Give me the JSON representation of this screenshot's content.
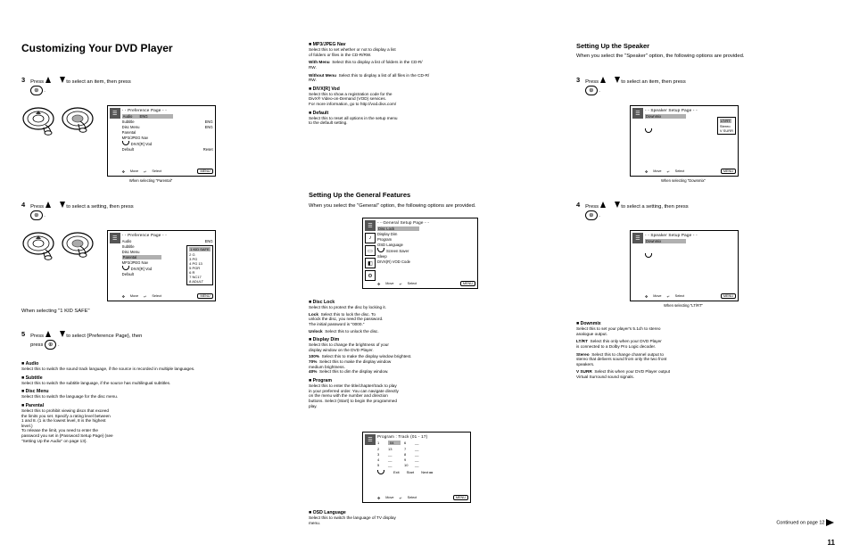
{
  "headings": {
    "customizing": "Customizing Your DVD Player",
    "generalSetup": "Setting Up the General Features",
    "speakerSetup": "Setting Up the Speaker"
  },
  "sub": {
    "step3": "Press      to select an item, then press",
    "step3tail": ".",
    "deflt": "Default",
    "defltTxt": "Select this to reset all options in the setup menu\nto the default setting.",
    "step4": "Press      to select a setting, then press",
    "step4tail": ".",
    "step5": "Press      to select {Preference Page}, then",
    "step5tail": "press     .",
    "parental": "Parental",
    "parentalTxt": "Select this to prohibit viewing discs that exceed\nthe limits you set. Specify a rating level between\n1 and 8. (1 is the lowest level, 8 is the highest\nlevel.)\nTo release the limit, you need to enter the\npassword you set in {Password Setup Page} (see\n\"Setting Up the Audio\" on page 13).",
    "divx": "DIVX[R] Vod",
    "divxTxt": "Select this to show a registration code for the\nDivX® Video-on-Demand (VOD) services.\nFor more information, go to http://vod.divx.com/",
    "mp3jpeg": "MP3/JPEG Nav",
    "mp3jpegTxt": "Select this to set whether or not to display a list\nof folders or files in the CD-R/RW.",
    "wMenu": "With Menu",
    "wMenuTxt": "Select this to display a list of folders in the CD-R/\nRW.",
    "woMenu": "Without Menu",
    "woMenuTxt": "Select this to display a list of all files in the CD-R/\nRW.",
    "audio": "Audio",
    "audioTxt": "Select this to switch the sound track language, if\nthe source is recorded in multiple languages.",
    "subtitle": "Subtitle",
    "subtitleTxt": "Select this to switch the subtitle language, if the\nsource has multilingual subtitles.",
    "discMenu": "Disc Menu",
    "discMenuTxt": "Select this to switch the language for the disc\nmenu.",
    "generalIntro": "When you select the \"General\" option, the\nfollowing options are provided.",
    "speakerIntro": "When you select the \"Speaker\" option, the\nfollowing options are provided.",
    "discLock": "Disc Lock",
    "discLockTxt": "Select this to protect the disc by locking it.",
    "lock": "Lock",
    "lockTxt": "Select this to lock the disc. To\nunlock the disc, you need the password.\nThe initial password is \"0000.\"",
    "unlock": "Unlock",
    "unlockTxt": "Select this to unlock the disc.",
    "display": "Display Dim",
    "displayTxt": "Select this to change the brightness of your\ndisplay window on the DVD Player.",
    "d100": "100%",
    "d100t": "Select this to make the display window brightest.",
    "d70": "70%",
    "d70t": "Select this to make the display window\nmedium brightness.",
    "d40": "40%",
    "d40t": "Select this to dim the display window.",
    "program": "Program",
    "programTxt": "Select this to enter the title/chapter/track to play\nin your preferred order. You can navigate directly\non the menu with the number and direction\nbuttons. Select {Start} to begin the programmed\nplay.",
    "osd": "OSD Language",
    "osdTxt": "Select this to switch the language of TV display\nmenu.",
    "s3": "Press      to select an item, then press",
    "s4": "Press      to select a setting, then press",
    "downmix": "Downmix",
    "downmixTxt": "Select this to set your player's 5.1ch to stereo\nanalogue output.",
    "ltrt": "LT/RT",
    "ltrtTxt": "Select this only when your DVD Player\nis connected to a Dolby Pro Logic decoder.",
    "stereo": "Stereo",
    "stereoTxt": "Select this to change channel output to\nstereo that delivers sound from only the two front\nspeakers.",
    "vsurr": "V SURR",
    "vsurrTxt": "Select this when your DVD Player output\nVirtual Surround sound signals.",
    "cont12": "Continued on page 12",
    "pageNum": "11",
    "move": "Move",
    "select": "Select",
    "menu": "MENU"
  },
  "osd_pref_a": {
    "title": "- - Preference Page - -",
    "items": [
      "Audio",
      "Subtitle",
      "Disc Menu",
      "Parental",
      "MP3/JPEG Nav",
      "DIVX[R] Vod",
      "Default"
    ],
    "vals": [
      "ENG",
      "ENG",
      "ENG",
      "",
      "",
      "",
      "Reset"
    ]
  },
  "osd_pref_b": {
    "title": "- - Preference Page - -",
    "items": [
      "Audio",
      "Subtitle",
      "Disc Menu",
      "Parental",
      "MP3/JPEG Nav",
      "DIVX[R] Vod",
      "Default"
    ],
    "vals": [
      "ENG",
      "ENG",
      "ENG",
      "",
      "",
      "",
      "Reset"
    ],
    "sub": [
      "1 KID SAFE",
      "2 G",
      "3 PG",
      "4 PG 13",
      "5 PGR",
      "6 R",
      "7 NC17",
      "8 ADULT"
    ]
  },
  "osd_general": {
    "title": "- - General Setup Page - -",
    "items": [
      "Disc Lock",
      "Display Dim",
      "Program",
      "OSD Language",
      "Screen Saver",
      "Sleep",
      "DIVX(R) VOD Code"
    ]
  },
  "osd_program": {
    "title": "Program : Track (01 - 17)",
    "grid": [
      [
        "1",
        "04",
        "6",
        "__"
      ],
      [
        "2",
        "13",
        "7",
        "__"
      ],
      [
        "3",
        "__",
        "8",
        "__"
      ],
      [
        "4",
        "__",
        "9",
        "__"
      ],
      [
        "5",
        "__",
        "10",
        "__"
      ]
    ],
    "actions": [
      "Exit",
      "Start",
      "Next ▸▸"
    ]
  },
  "osd_speaker_a": {
    "title": "- - Speaker Setup Page - -",
    "items": [
      "Downmix"
    ],
    "sub": [
      "LT/RT",
      "Stereo",
      "V SURR"
    ]
  },
  "osd_speaker_b": {
    "title": "- - Speaker Setup Page - -",
    "items": [
      "Downmix"
    ]
  }
}
